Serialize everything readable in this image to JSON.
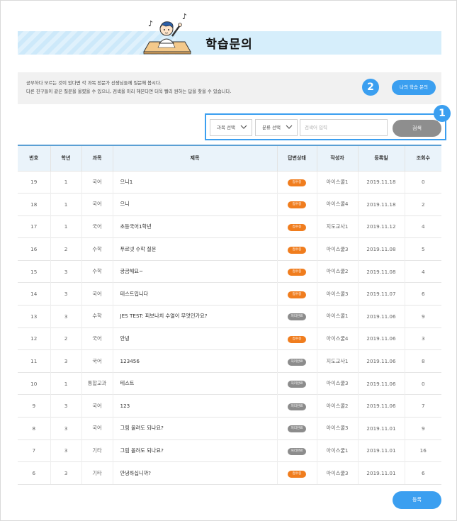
{
  "header": {
    "title": "학습문의"
  },
  "info": {
    "line1": "공부하다 모르는 것이 있다면 각 과목 전문가 선생님들께 질문해 봅시다.",
    "line2": "다른 친구들이 같은 질문을 올렸을 수 있으니, 검색을 미리 해본다면 더욱 빨리 원하는 답을 찾을 수 있습니다.",
    "my_questions_label": "나의 학습 문의"
  },
  "badges": {
    "first": "1",
    "second": "2"
  },
  "search": {
    "subject_select": "과목 선택",
    "category_select": "분류 선택",
    "keyword_placeholder": "검색어 입력",
    "search_label": "검색"
  },
  "table": {
    "columns": [
      "번호",
      "학년",
      "과목",
      "제목",
      "답변상태",
      "작성자",
      "등록일",
      "조회수"
    ],
    "rows": [
      {
        "no": "19",
        "grade": "1",
        "subject": "국어",
        "title": "으니1",
        "status": "접수중",
        "status_color": "#f07d1e",
        "author": "아이스쿨1",
        "date": "2019.11.18",
        "views": "0"
      },
      {
        "no": "18",
        "grade": "1",
        "subject": "국어",
        "title": "으니",
        "status": "접수중",
        "status_color": "#f07d1e",
        "author": "아이스쿨4",
        "date": "2019.11.18",
        "views": "2"
      },
      {
        "no": "17",
        "grade": "1",
        "subject": "국어",
        "title": "초등국어1학년",
        "status": "접수중",
        "status_color": "#f07d1e",
        "author": "지도교사1",
        "date": "2019.11.12",
        "views": "4"
      },
      {
        "no": "16",
        "grade": "2",
        "subject": "수학",
        "title": "푸르넷 수학 질문",
        "status": "접수중",
        "status_color": "#f07d1e",
        "author": "아이스쿨3",
        "date": "2019.11.08",
        "views": "5"
      },
      {
        "no": "15",
        "grade": "3",
        "subject": "수학",
        "title": "궁금해요~",
        "status": "접수중",
        "status_color": "#f07d1e",
        "author": "아이스쿨2",
        "date": "2019.11.08",
        "views": "4"
      },
      {
        "no": "14",
        "grade": "3",
        "subject": "국어",
        "title": "테스트입니다",
        "status": "접수중",
        "status_color": "#f07d1e",
        "author": "아이스쿨3",
        "date": "2019.11.07",
        "views": "6"
      },
      {
        "no": "13",
        "grade": "3",
        "subject": "수학",
        "title": "JES TEST: 피보나치 수열이 무엇인가요?",
        "status": "처리완료",
        "status_color": "#8c8c8c",
        "author": "아이스쿨1",
        "date": "2019.11.06",
        "views": "9"
      },
      {
        "no": "12",
        "grade": "2",
        "subject": "국어",
        "title": "안녕",
        "status": "접수중",
        "status_color": "#f07d1e",
        "author": "아이스쿨4",
        "date": "2019.11.06",
        "views": "3"
      },
      {
        "no": "11",
        "grade": "3",
        "subject": "국어",
        "title": "123456",
        "status": "처리완료",
        "status_color": "#8c8c8c",
        "author": "지도교사1",
        "date": "2019.11.06",
        "views": "8"
      },
      {
        "no": "10",
        "grade": "1",
        "subject": "통합교과",
        "title": "테스트",
        "status": "처리완료",
        "status_color": "#8c8c8c",
        "author": "아이스쿨3",
        "date": "2019.11.06",
        "views": "0"
      },
      {
        "no": "9",
        "grade": "3",
        "subject": "국어",
        "title": "123",
        "status": "처리완료",
        "status_color": "#8c8c8c",
        "author": "아이스쿨2",
        "date": "2019.11.06",
        "views": "7"
      },
      {
        "no": "8",
        "grade": "3",
        "subject": "국어",
        "title": "그림 올려도 되나요?",
        "status": "처리완료",
        "status_color": "#8c8c8c",
        "author": "아이스쿨3",
        "date": "2019.11.01",
        "views": "9"
      },
      {
        "no": "7",
        "grade": "3",
        "subject": "기타",
        "title": "그림 올려도 되나요?",
        "status": "처리완료",
        "status_color": "#8c8c8c",
        "author": "아이스쿨1",
        "date": "2019.11.01",
        "views": "16"
      },
      {
        "no": "6",
        "grade": "3",
        "subject": "기타",
        "title": "안녕하십니까?",
        "status": "접수중",
        "status_color": "#f07d1e",
        "author": "아이스쿨3",
        "date": "2019.11.01",
        "views": "6"
      }
    ]
  },
  "footer": {
    "register_label": "등록"
  },
  "colors": {
    "accent": "#3b9ff0",
    "received": "#f07d1e",
    "done": "#8c8c8c",
    "search_button": "#8e8e8e"
  }
}
